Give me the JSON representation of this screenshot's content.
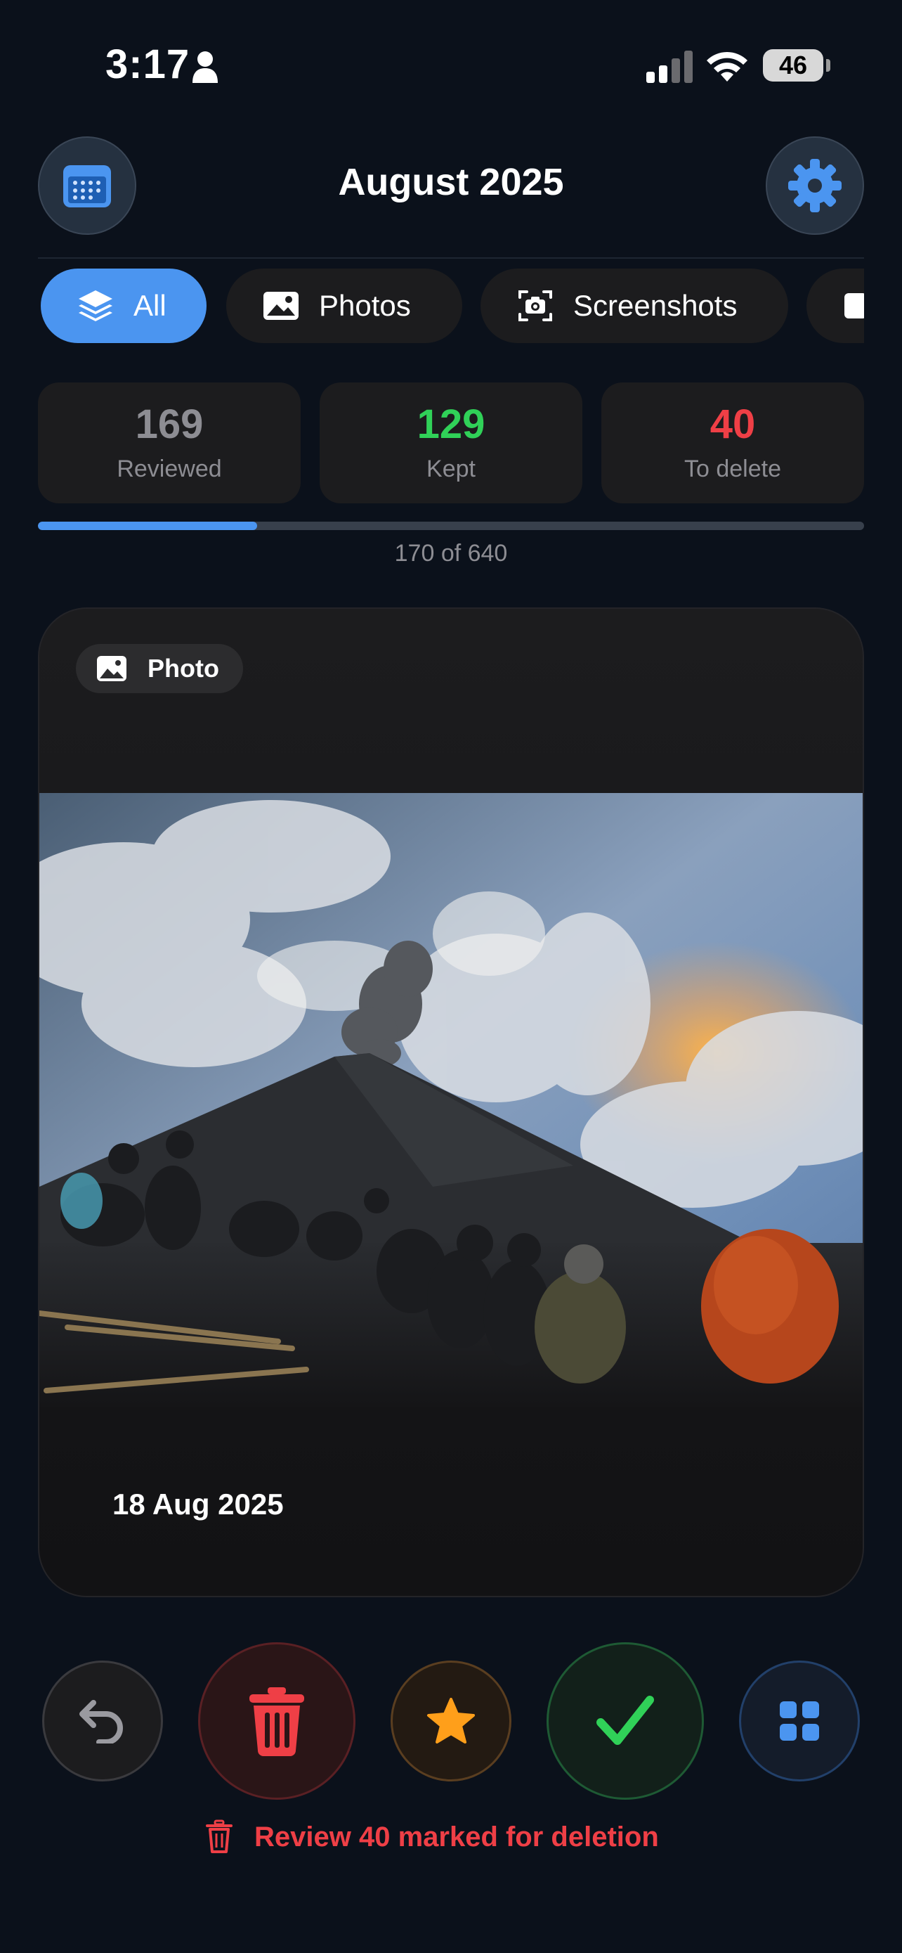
{
  "status_bar": {
    "time": "3:17",
    "battery": "46"
  },
  "header": {
    "title": "August 2025",
    "calendar_icon": "calendar-icon",
    "settings_icon": "gear-icon"
  },
  "filters": [
    {
      "label": "All",
      "icon": "stack-icon",
      "selected": true
    },
    {
      "label": "Photos",
      "icon": "image-icon",
      "selected": false
    },
    {
      "label": "Screenshots",
      "icon": "screenshot-icon",
      "selected": false
    },
    {
      "label": "",
      "icon": "video-icon",
      "selected": false
    }
  ],
  "stats": {
    "reviewed": {
      "value": "169",
      "label": "Reviewed",
      "color": "#8d8d93"
    },
    "kept": {
      "value": "129",
      "label": "Kept",
      "color": "#30d158"
    },
    "to_delete": {
      "value": "40",
      "label": "To delete",
      "color": "#ef3f46"
    }
  },
  "progress": {
    "current": 170,
    "total": 640,
    "text": "170 of 640",
    "color": "#4b95f0"
  },
  "card": {
    "type_label": "Photo",
    "date": "18 Aug 2025"
  },
  "actions": {
    "undo_icon": "undo-icon",
    "delete_icon": "trash-icon",
    "favorite_icon": "star-icon",
    "keep_icon": "checkmark-icon",
    "grid_icon": "grid-icon",
    "review_text": "Review 40 marked for deletion"
  },
  "colors": {
    "accent": "#4b95f0",
    "delete": "#ef3f46",
    "keep": "#30d158",
    "favorite": "#ff9f1a",
    "background": "#0b111b"
  }
}
